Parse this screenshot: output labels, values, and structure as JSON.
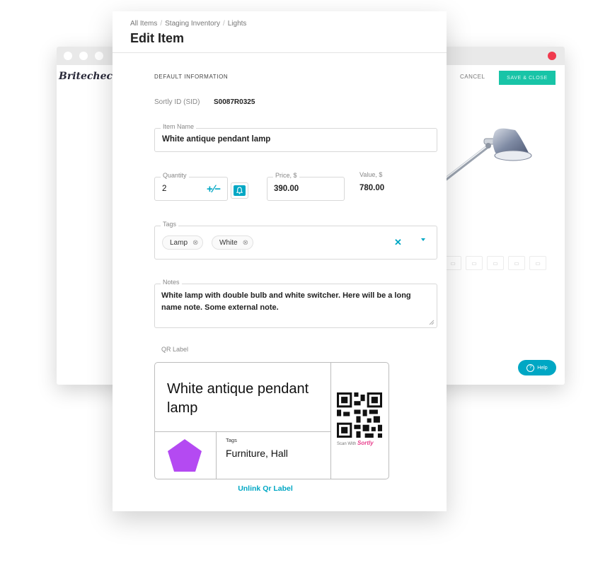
{
  "background_window": {
    "brand": "Britecheck",
    "cancel_label": "CANCEL",
    "save_close_label": "SAVE & CLOSE",
    "help_label": "Help",
    "accent_color": "#18c4a7"
  },
  "dialog": {
    "breadcrumbs": [
      "All Items",
      "Staging Inventory",
      "Lights"
    ],
    "title": "Edit Item",
    "section_title": "DEFAULT INFORMATION",
    "sid": {
      "label": "Sortly ID (SID)",
      "value": "S0087R0325"
    },
    "item_name": {
      "label": "Item Name",
      "value": "White antique pendant lamp"
    },
    "quantity": {
      "label": "Quantity",
      "value": "2",
      "stepper_icon": "plus-minus-icon",
      "alert_icon": "bell-icon"
    },
    "price": {
      "label": "Price, $",
      "value": "390.00"
    },
    "total_value": {
      "label": "Value, $",
      "value": "780.00"
    },
    "tags": {
      "label": "Tags",
      "items": [
        "Lamp",
        "White"
      ]
    },
    "notes": {
      "label": "Notes",
      "value": "White lamp with double bulb and white switcher. Here will be a long name note. Some external note."
    },
    "qr_label": {
      "label": "QR Label",
      "name": "White antique pendant lamp",
      "tags_label": "Tags",
      "tags_value": "Furniture, Hall",
      "scan_text": "Scan With",
      "scan_brand": "Sortly",
      "shape_color": "#b44af2"
    },
    "unlink_label": "Unlink Qr Label",
    "accent_color": "#00a7c4"
  }
}
